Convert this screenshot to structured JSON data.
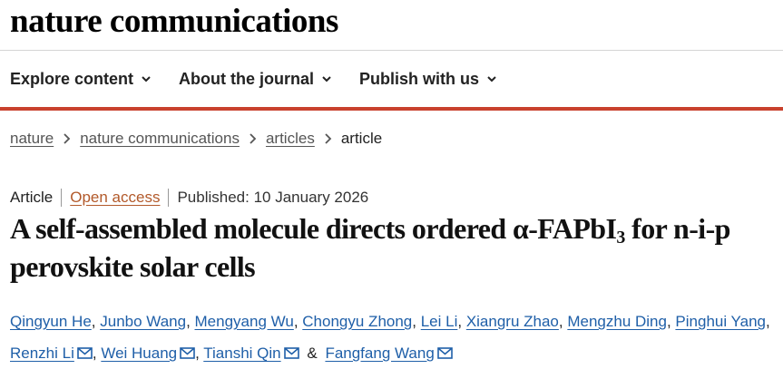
{
  "brand": {
    "name": "nature communications"
  },
  "nav": {
    "items": [
      {
        "label": "Explore content"
      },
      {
        "label": "About the journal"
      },
      {
        "label": "Publish with us"
      }
    ]
  },
  "breadcrumb": {
    "items": [
      {
        "label": "nature"
      },
      {
        "label": "nature communications"
      },
      {
        "label": "articles"
      }
    ],
    "current": "article"
  },
  "meta": {
    "type": "Article",
    "open_access": "Open access",
    "published": "Published: 10 January 2026"
  },
  "article": {
    "title_pre": "A self-assembled molecule directs ordered α-FAPbI",
    "title_sub": "3",
    "title_post": " for n-i-p perovskite solar cells"
  },
  "authors": [
    {
      "name": "Qingyun He"
    },
    {
      "name": "Junbo Wang"
    },
    {
      "name": "Mengyang Wu"
    },
    {
      "name": "Chongyu Zhong"
    },
    {
      "name": "Lei Li"
    },
    {
      "name": "Xiangru Zhao"
    },
    {
      "name": "Mengzhu Ding"
    },
    {
      "name": "Pinghui Yang"
    },
    {
      "name": "Renzhi Li"
    },
    {
      "name": "Wei Huang"
    },
    {
      "name": "Tianshi Qin"
    },
    {
      "name": "Fangfang Wang"
    }
  ],
  "authors_conjunction": "&",
  "colors": {
    "accent_bar": "#c9412d",
    "link": "#1f5fa8",
    "open_access": "#b2592a"
  },
  "icons": {
    "nav_dropdown": "chevron-down-icon",
    "breadcrumb_separator": "chevron-right-icon",
    "author_contact": "mail-icon"
  }
}
